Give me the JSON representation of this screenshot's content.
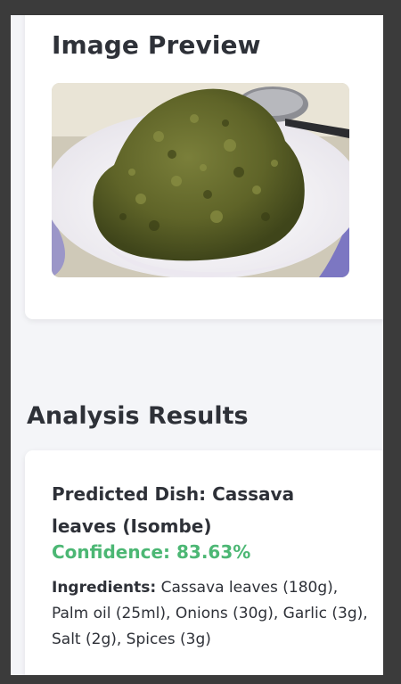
{
  "preview": {
    "title": "Image Preview",
    "image_alt": "Cassava leaves dish in a white bowl with a spoon"
  },
  "results": {
    "heading": "Analysis Results",
    "dish_label": "Predicted Dish: Cassava leaves (Isombe)",
    "confidence": "Confidence: 83.63%",
    "ingredients_label": "Ingredients:",
    "ingredients_text": " Cassava leaves (180g), Palm oil (25ml), Onions (30g), Garlic (3g), Salt (2g), Spices (3g)"
  },
  "colors": {
    "confidence": "#4cb774",
    "text": "#2e3138",
    "page_bg": "#f4f5f8",
    "frame": "#3b3b3b"
  }
}
